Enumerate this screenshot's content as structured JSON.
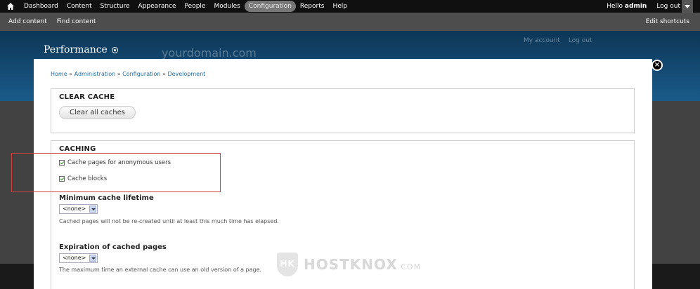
{
  "toolbar": {
    "items": [
      "Dashboard",
      "Content",
      "Structure",
      "Appearance",
      "People",
      "Modules",
      "Configuration",
      "Reports",
      "Help"
    ],
    "active": "Configuration",
    "hello_prefix": "Hello",
    "username": "admin",
    "logout": "Log out"
  },
  "shortcuts": {
    "add_content": "Add content",
    "find_content": "Find content",
    "edit_shortcuts": "Edit shortcuts"
  },
  "header": {
    "title": "Performance",
    "site_name": "yourdomain.com",
    "my_account": "My account",
    "log_out": "Log out"
  },
  "breadcrumb": {
    "items": [
      "Home",
      "Administration",
      "Configuration",
      "Development"
    ],
    "separator": "»"
  },
  "clear_cache": {
    "legend": "CLEAR CACHE",
    "button": "Clear all caches"
  },
  "caching": {
    "legend": "CACHING",
    "cache_pages_label": "Cache pages for anonymous users",
    "cache_pages_checked": true,
    "cache_blocks_label": "Cache blocks",
    "cache_blocks_checked": true,
    "min_lifetime_label": "Minimum cache lifetime",
    "min_lifetime_value": "<none>",
    "min_lifetime_desc": "Cached pages will not be re-created until at least this much time has elapsed.",
    "expiration_label": "Expiration of cached pages",
    "expiration_value": "<none>",
    "expiration_desc": "The maximum time an external cache can use an old version of a page."
  },
  "watermark": {
    "logo": "HK",
    "text": "HOSTKNOX",
    "suffix": ".COM"
  },
  "colors": {
    "toolbar": "#101010",
    "header": "#1a5b8a",
    "link": "#1f6aa0",
    "highlight": "#d04040"
  }
}
